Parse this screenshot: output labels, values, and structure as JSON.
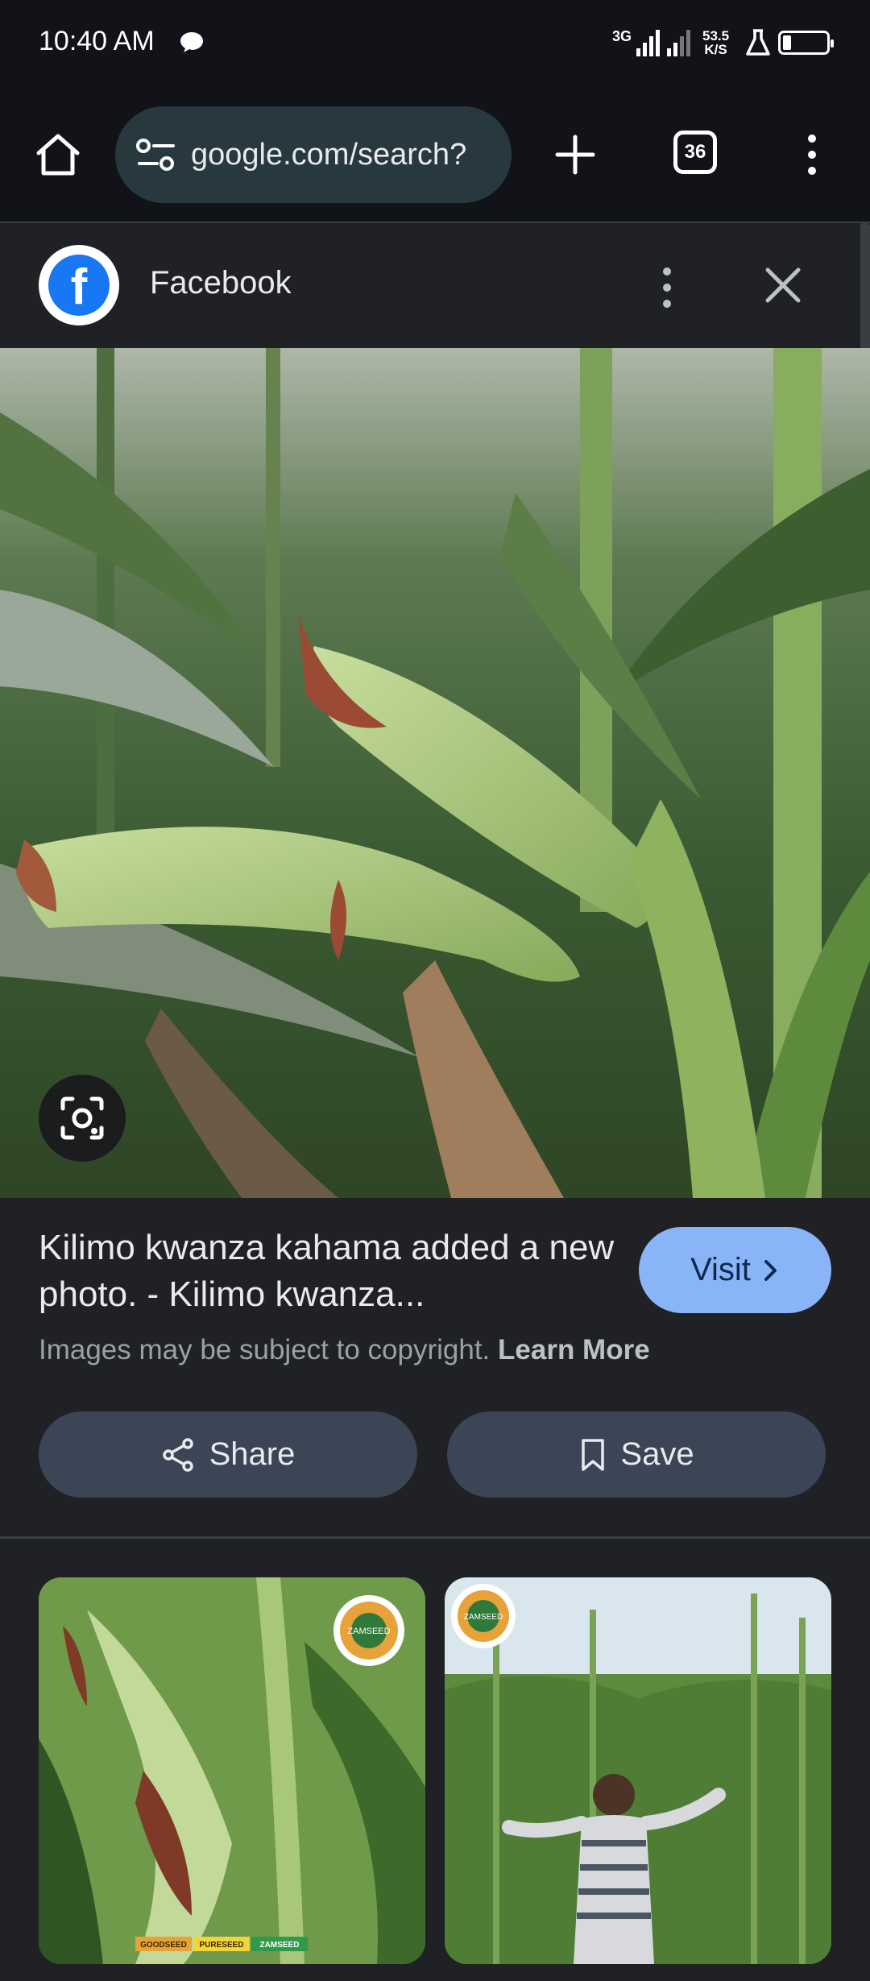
{
  "status_bar": {
    "time": "10:40 AM",
    "network_type": "3G",
    "speed_value": "53.5",
    "speed_unit": "K/S",
    "icons": [
      "chat-bubble-icon",
      "signal-icon",
      "signal-weak-icon",
      "flask-icon",
      "battery-icon"
    ]
  },
  "browser": {
    "url": "google.com/search?",
    "tab_count": "36",
    "icons": [
      "home-icon",
      "site-settings-icon",
      "new-tab-icon",
      "menu-icon"
    ]
  },
  "source": {
    "name": "Facebook",
    "logo_letter": "f",
    "brand_color": "#1877f2",
    "icons": [
      "more-vert-icon",
      "close-icon"
    ]
  },
  "result": {
    "title": "Kilimo kwanza kahama added a new photo. - Kilimo kwanza...",
    "visit_label": "Visit",
    "copyright_text": "Images may be subject to copyright.",
    "learn_more_label": "Learn More",
    "share_label": "Share",
    "save_label": "Save",
    "accent_color": "#8ab4f8"
  },
  "related": {
    "thumb1_banner": [
      "GOODSEED",
      "PURESEED",
      "ZAMSEED"
    ],
    "thumb1_logo": "ZAMSEED",
    "thumb2_logo": "ZAMSEED"
  }
}
